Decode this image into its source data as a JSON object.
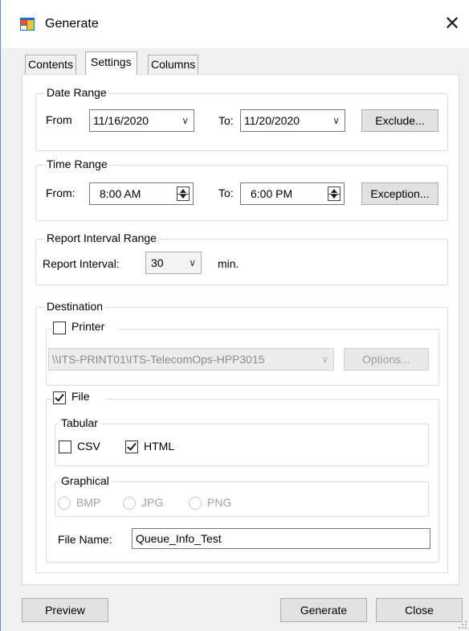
{
  "window": {
    "title": "Generate"
  },
  "tabs": [
    {
      "label": "Contents"
    },
    {
      "label": "Settings",
      "active": true
    },
    {
      "label": "Columns"
    }
  ],
  "date_range": {
    "group_label": "Date Range",
    "from_label": "From",
    "from_value": "11/16/2020",
    "to_label": "To:",
    "to_value": "11/20/2020",
    "exclude_label": "Exclude..."
  },
  "time_range": {
    "group_label": "Time Range",
    "from_label": "From:",
    "from_value": "8:00 AM",
    "to_label": "To:",
    "to_value": "6:00 PM",
    "exception_label": "Exception..."
  },
  "report_interval": {
    "group_label": "Report Interval Range",
    "label": "Report Interval:",
    "value": "30",
    "unit": "min."
  },
  "destination": {
    "group_label": "Destination",
    "printer": {
      "label": "Printer",
      "checked": false,
      "selected": "\\\\ITS-PRINT01\\ITS-TelecomOps-HPP3015",
      "options_label": "Options..."
    },
    "file": {
      "label": "File",
      "checked": true,
      "tabular": {
        "group_label": "Tabular",
        "csv_label": "CSV",
        "csv_checked": false,
        "html_label": "HTML",
        "html_checked": true
      },
      "graphical": {
        "group_label": "Graphical",
        "bmp_label": "BMP",
        "jpg_label": "JPG",
        "png_label": "PNG"
      },
      "file_name_label": "File Name:",
      "file_name_value": "Queue_Info_Test"
    }
  },
  "footer": {
    "preview_label": "Preview",
    "generate_label": "Generate",
    "close_label": "Close"
  },
  "colors": {
    "window_border": "#6b8fd4",
    "dialog_bg": "#f0f0f0"
  }
}
